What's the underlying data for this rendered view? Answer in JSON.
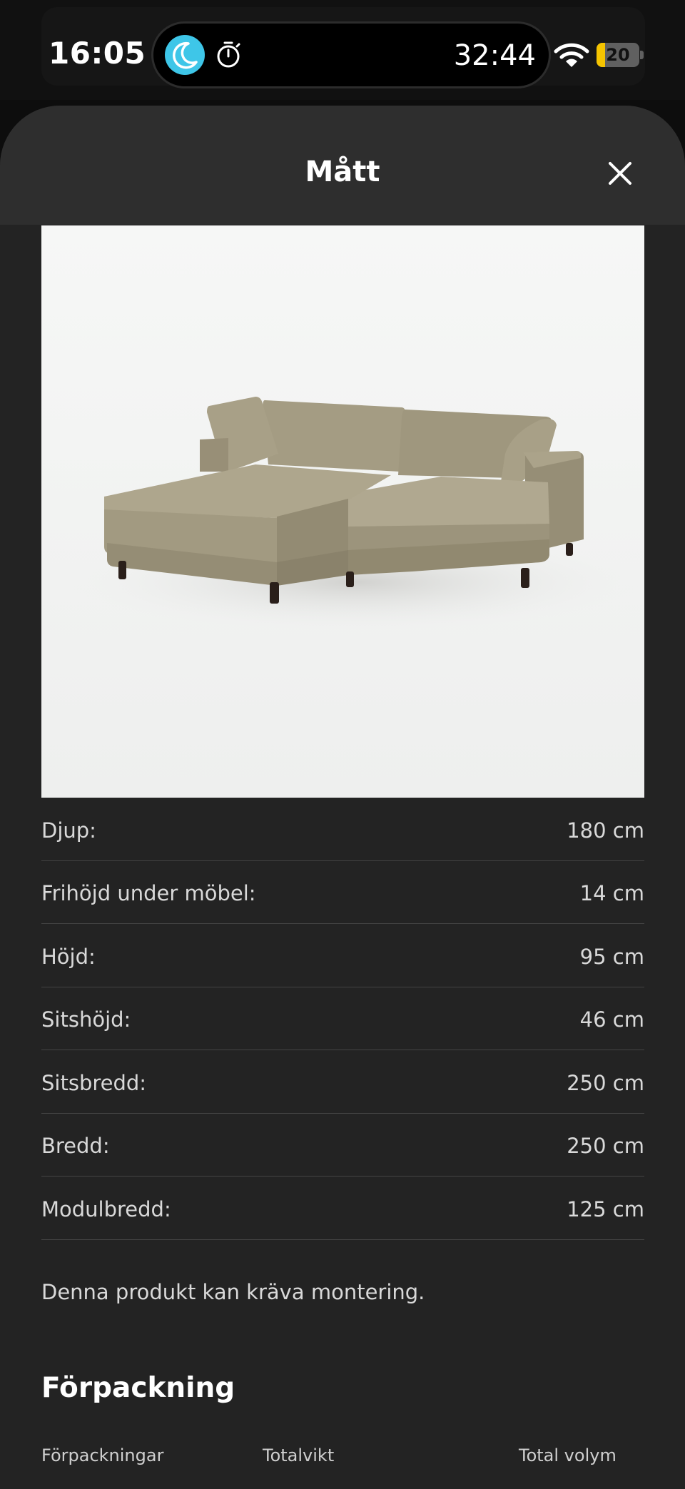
{
  "status_bar": {
    "time": "16:05",
    "timer": "32:44",
    "battery": "20",
    "battery_level": 0.2,
    "icons": [
      "moon-icon",
      "timer-icon",
      "wifi-icon",
      "battery-icon"
    ],
    "moon_color": "#3ec6e8",
    "battery_color": "#f5c400"
  },
  "sheet": {
    "title": "Mått",
    "close_icon": "close-icon"
  },
  "product": {
    "image": "sofa-with-chaise"
  },
  "dimensions": [
    {
      "label": "Djup:",
      "value": "180 cm"
    },
    {
      "label": "Frihöjd under möbel:",
      "value": "14 cm"
    },
    {
      "label": "Höjd:",
      "value": "95 cm"
    },
    {
      "label": "Sitshöjd:",
      "value": "46 cm"
    },
    {
      "label": "Sitsbredd:",
      "value": "250 cm"
    },
    {
      "label": "Bredd:",
      "value": "250 cm"
    },
    {
      "label": "Modulbredd:",
      "value": "125 cm"
    }
  ],
  "assembly_note": "Denna produkt kan kräva montering.",
  "packaging": {
    "title": "Förpackning",
    "columns": [
      "Förpackningar",
      "Totalvikt",
      "Total volym"
    ]
  }
}
